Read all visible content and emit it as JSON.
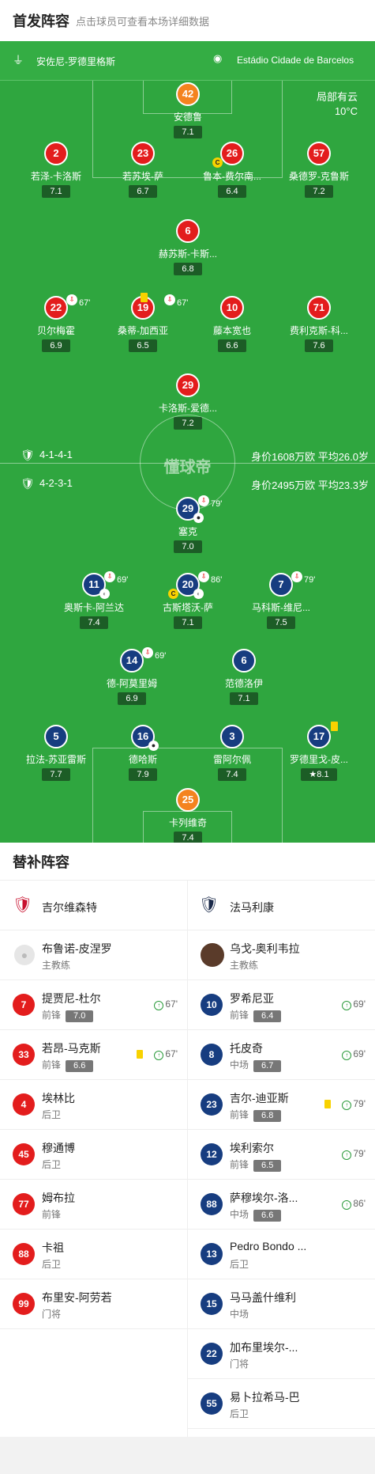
{
  "header": {
    "title": "首发阵容",
    "subtitle": "点击球员可查看本场详细数据"
  },
  "pitch": {
    "referee": "安佐尼-罗德里格斯",
    "stadium": "Estádio Cidade de Barcelos",
    "weather": "局部有云",
    "temperature": "10°C",
    "watermark": "懂球帝",
    "home": {
      "formation": "4-1-4-1",
      "value": "身价1608万欧 平均26.0岁"
    },
    "away": {
      "formation": "4-2-3-1",
      "value": "身价2495万欧 平均23.3岁"
    }
  },
  "home_players": [
    {
      "num": "42",
      "name": "安德鲁",
      "rating": "7.1"
    },
    {
      "num": "2",
      "name": "若泽-卡洛斯",
      "rating": "7.1"
    },
    {
      "num": "23",
      "name": "若苏埃-萨",
      "rating": "6.7"
    },
    {
      "num": "26",
      "name": "鲁本-费尔南...",
      "rating": "6.4"
    },
    {
      "num": "57",
      "name": "桑德罗-克鲁斯",
      "rating": "7.2"
    },
    {
      "num": "6",
      "name": "赫苏斯-卡斯...",
      "rating": "6.8"
    },
    {
      "num": "22",
      "name": "贝尔梅霍",
      "rating": "6.9",
      "sub": "67'"
    },
    {
      "num": "19",
      "name": "桑蒂-加西亚",
      "rating": "6.5",
      "sub": "67'"
    },
    {
      "num": "10",
      "name": "藤本宽也",
      "rating": "6.6"
    },
    {
      "num": "71",
      "name": "费利克斯-科...",
      "rating": "7.6"
    },
    {
      "num": "29",
      "name": "卡洛斯-爱德...",
      "rating": "7.2"
    }
  ],
  "away_players": [
    {
      "num": "29",
      "name": "塞克",
      "rating": "7.0",
      "sub": "79'"
    },
    {
      "num": "11",
      "name": "奥斯卡-阿兰达",
      "rating": "7.4",
      "sub": "69'"
    },
    {
      "num": "20",
      "name": "古斯塔沃-萨",
      "rating": "7.1",
      "sub": "86'"
    },
    {
      "num": "7",
      "name": "马科斯-维尼...",
      "rating": "7.5",
      "sub": "79'"
    },
    {
      "num": "14",
      "name": "德-阿莫里姆",
      "rating": "6.9",
      "sub": "69'"
    },
    {
      "num": "6",
      "name": "范德洛伊",
      "rating": "7.1"
    },
    {
      "num": "5",
      "name": "拉法-苏亚雷斯",
      "rating": "7.7"
    },
    {
      "num": "16",
      "name": "德哈斯",
      "rating": "7.9"
    },
    {
      "num": "3",
      "name": "雷阿尔佩",
      "rating": "7.4"
    },
    {
      "num": "17",
      "name": "罗德里戈-皮...",
      "rating": "8.1"
    },
    {
      "num": "25",
      "name": "卡列维奇",
      "rating": "7.4"
    }
  ],
  "subs": {
    "title": "替补阵容",
    "home": {
      "team": "吉尔维森特",
      "coach": {
        "name": "布鲁诺-皮涅罗",
        "role": "主教练"
      },
      "players": [
        {
          "num": "7",
          "name": "提贾尼-杜尔",
          "pos": "前锋",
          "rating": "7.0",
          "in": "67'"
        },
        {
          "num": "33",
          "name": "若昂-马克斯",
          "pos": "前锋",
          "rating": "6.6",
          "in": "67'"
        },
        {
          "num": "4",
          "name": "埃林比",
          "pos": "后卫"
        },
        {
          "num": "45",
          "name": "穆通博",
          "pos": "后卫"
        },
        {
          "num": "77",
          "name": "姆布拉",
          "pos": "前锋"
        },
        {
          "num": "88",
          "name": "卡祖",
          "pos": "后卫"
        },
        {
          "num": "99",
          "name": "布里安-阿劳若",
          "pos": "门将"
        }
      ]
    },
    "away": {
      "team": "法马利康",
      "coach": {
        "name": "乌戈-奥利韦拉",
        "role": "主教练"
      },
      "players": [
        {
          "num": "10",
          "name": "罗希尼亚",
          "pos": "前锋",
          "rating": "6.4",
          "in": "69'"
        },
        {
          "num": "8",
          "name": "托皮奇",
          "pos": "中场",
          "rating": "6.7",
          "in": "69'"
        },
        {
          "num": "23",
          "name": "吉尔-迪亚斯",
          "pos": "前锋",
          "rating": "6.8",
          "in": "79'"
        },
        {
          "num": "12",
          "name": "埃利索尔",
          "pos": "前锋",
          "rating": "6.5",
          "in": "79'"
        },
        {
          "num": "88",
          "name": "萨穆埃尔-洛...",
          "pos": "中场",
          "rating": "6.6",
          "in": "86'"
        },
        {
          "num": "13",
          "name": "Pedro Bondo ...",
          "pos": "后卫"
        },
        {
          "num": "15",
          "name": "马马盖什维利",
          "pos": "中场"
        },
        {
          "num": "22",
          "name": "加布里埃尔-...",
          "pos": "门将"
        },
        {
          "num": "55",
          "name": "易卜拉希马-巴",
          "pos": "后卫"
        }
      ]
    }
  },
  "colors": {
    "home": "#e31d1d",
    "away": "#173d80",
    "keeper": "#f4831f",
    "pitch": "#2fa63f"
  }
}
